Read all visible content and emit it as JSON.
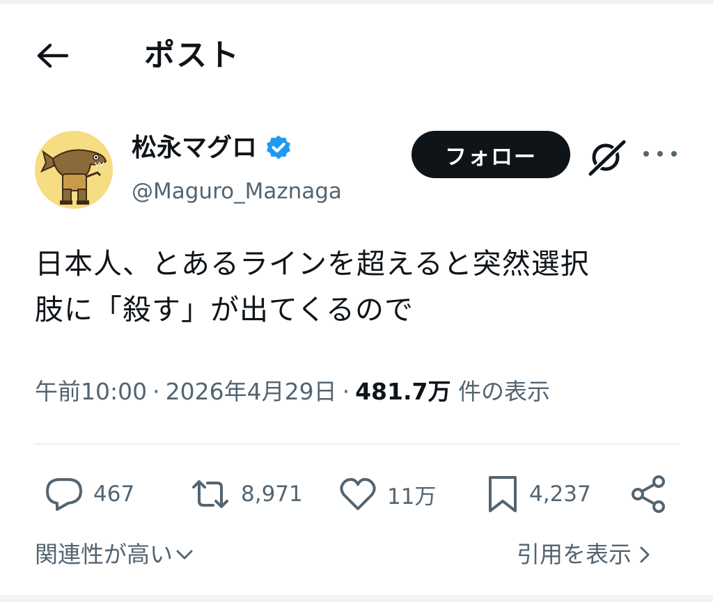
{
  "header": {
    "title": "ポスト",
    "back_icon": "arrow-left-icon"
  },
  "author": {
    "display_name": "松永マグロ",
    "handle": "@Maguro_Maznaga",
    "verified": true,
    "verified_color": "#1d9bf0",
    "avatar_bg": "#f6dc82"
  },
  "follow_button": {
    "label": "フォロー"
  },
  "post": {
    "text_line1": "日本人、とあるラインを超えると突然選択",
    "text_line2": "肢に「殺す」が出てくるので"
  },
  "meta": {
    "time": "午前10:00",
    "date": "2026年4月29日",
    "separator": "·",
    "views": "481.7万",
    "views_suffix": "件の表示"
  },
  "actions": {
    "replies": "467",
    "reposts": "8,971",
    "likes": "11万",
    "bookmarks": "4,237"
  },
  "footer": {
    "sort_label": "関連性が高い",
    "quotes_label": "引用を表示"
  },
  "colors": {
    "text": "#0f1419",
    "muted": "#536471",
    "divider": "#eceef0"
  }
}
